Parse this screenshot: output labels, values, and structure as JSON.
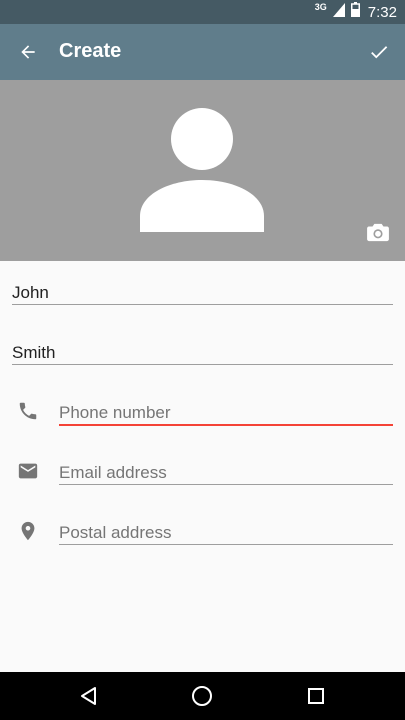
{
  "status_bar": {
    "network": "3G",
    "time": "7:32"
  },
  "app_bar": {
    "title": "Create",
    "back_icon": "arrow-back-icon",
    "done_icon": "check-icon",
    "color": "#607d8b"
  },
  "photo": {
    "placeholder_icon": "person-silhouette-icon",
    "camera_icon": "camera-icon",
    "background": "#9e9e9e"
  },
  "form": {
    "first_name": {
      "value": "John"
    },
    "last_name": {
      "value": "Smith"
    },
    "phone": {
      "placeholder": "Phone number",
      "icon": "phone-icon",
      "focused": true
    },
    "email": {
      "placeholder": "Email address",
      "icon": "email-icon"
    },
    "postal": {
      "placeholder": "Postal address",
      "icon": "location-pin-icon"
    }
  },
  "accent_color": "#f44336",
  "nav_bar": {
    "back": "back-triangle-icon",
    "home": "home-circle-icon",
    "recents": "recents-square-icon"
  }
}
